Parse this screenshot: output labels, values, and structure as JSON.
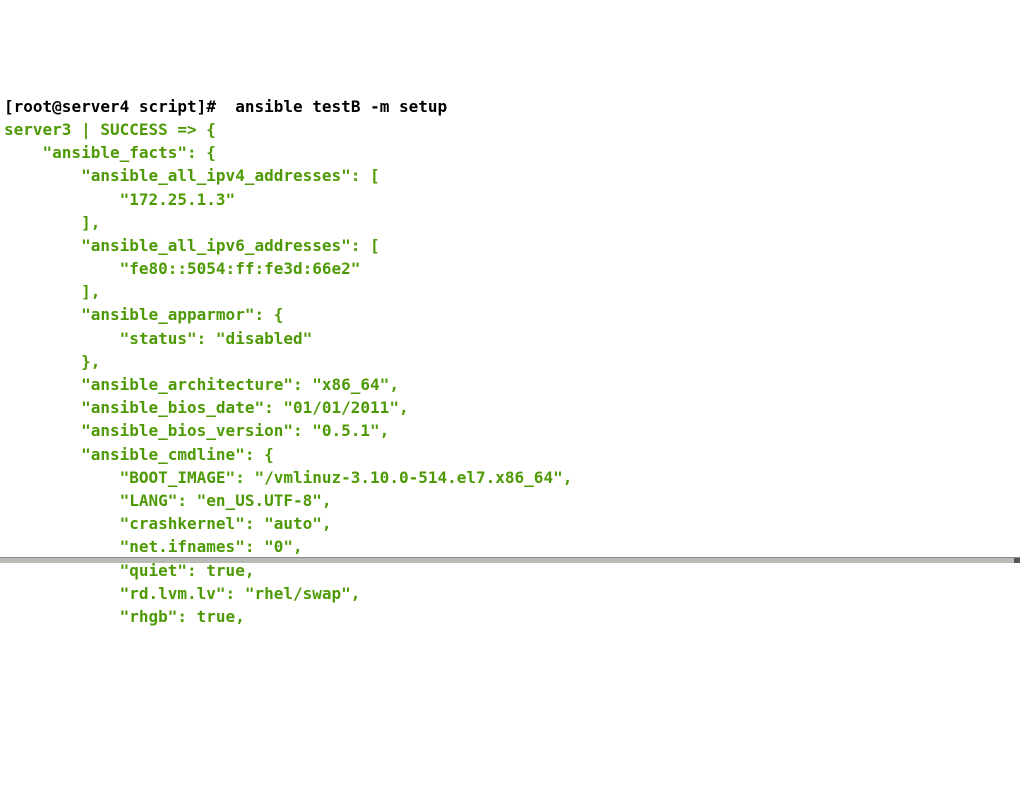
{
  "prompt": {
    "open_bracket": "[",
    "user_host": "root@server4",
    "space1": " ",
    "path": "script",
    "close_bracket": "]",
    "hash": "#  ",
    "command": "ansible testB -m setup"
  },
  "lines": {
    "l01": "server3 | SUCCESS => {",
    "l02": "    \"ansible_facts\": {",
    "l03": "        \"ansible_all_ipv4_addresses\": [",
    "l04": "            \"172.25.1.3\"",
    "l05": "        ], ",
    "l06": "        \"ansible_all_ipv6_addresses\": [",
    "l07": "            \"fe80::5054:ff:fe3d:66e2\"",
    "l08": "        ], ",
    "l09": "        \"ansible_apparmor\": {",
    "l10": "            \"status\": \"disabled\"",
    "l11": "        }, ",
    "l12": "        \"ansible_architecture\": \"x86_64\", ",
    "l13": "        \"ansible_bios_date\": \"01/01/2011\", ",
    "l14": "        \"ansible_bios_version\": \"0.5.1\", ",
    "l15": "        \"ansible_cmdline\": {",
    "l16": "            \"BOOT_IMAGE\": \"/vmlinuz-3.10.0-514.el7.x86_64\", ",
    "l17": "            \"LANG\": \"en_US.UTF-8\", ",
    "l18": "            \"crashkernel\": \"auto\", ",
    "l19": "            \"net.ifnames\": \"0\", ",
    "l20": "            \"quiet\": true, ",
    "l21": "            \"rd.lvm.lv\": \"rhel/swap\", ",
    "l22": "            \"rhgb\": true, "
  }
}
